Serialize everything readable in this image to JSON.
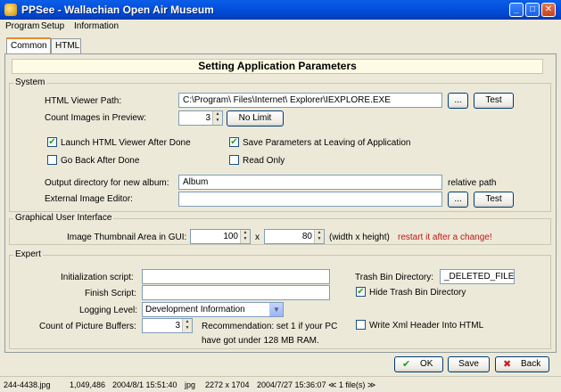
{
  "window": {
    "title": "PPSee - Wallachian Open Air Museum"
  },
  "menu": [
    "Program",
    "Setup",
    "Information"
  ],
  "tabs": [
    "Common",
    "HTML"
  ],
  "header": "Setting Application Parameters",
  "system": {
    "legend": "System",
    "html_viewer_label": "HTML Viewer Path:",
    "html_viewer_value": "C:\\Program\\ Files\\Internet\\ Explorer\\IEXPLORE.EXE",
    "browse_label": "...",
    "test_label": "Test",
    "count_images_label": "Count Images in Preview:",
    "count_images_value": "3",
    "no_limit_label": "No Limit",
    "launch_viewer_label": "Launch HTML Viewer After Done",
    "launch_viewer_checked": true,
    "save_params_label": "Save Parameters at Leaving of Application",
    "save_params_checked": true,
    "go_back_label": "Go Back After Done",
    "go_back_checked": false,
    "read_only_label": "Read Only",
    "read_only_checked": false,
    "output_dir_label": "Output directory for new album:",
    "output_dir_value": "Album",
    "relative_path_label": "relative path",
    "external_editor_label": "External Image Editor:",
    "external_editor_value": "",
    "browse2_label": "...",
    "test2_label": "Test"
  },
  "gui": {
    "legend": "Graphical User Interface",
    "thumb_label": "Image Thumbnail Area in GUI:",
    "width_value": "100",
    "x_label": "x",
    "height_value": "80",
    "wh_label": "(width x height)",
    "restart_label": "restart it after a change!"
  },
  "expert": {
    "legend": "Expert",
    "init_label": "Initialization script:",
    "init_value": "",
    "finish_label": "Finish Script:",
    "finish_value": "",
    "logging_label": "Logging Level:",
    "logging_value": "Development Information",
    "buffers_label": "Count of Picture Buffers:",
    "buffers_value": "3",
    "recommend_line1": "Recommendation: set 1 if your PC",
    "recommend_line2": "have got under 128 MB RAM.",
    "trash_label": "Trash Bin Directory:",
    "trash_value": "_DELETED_FILES",
    "hide_trash_label": "Hide Trash Bin Directory",
    "hide_trash_checked": true,
    "xml_header_label": "Write Xml Header Into HTML",
    "xml_header_checked": false
  },
  "buttons": {
    "ok": "OK",
    "save": "Save",
    "back": "Back"
  },
  "status": {
    "filename": "244-4438.jpg",
    "size": "1,049,486",
    "date1": "2004/8/1 15:51:40",
    "format": "jpg",
    "dimensions": "2272 x 1704",
    "date2": "2004/7/27 15:36:07",
    "count": "≪ 1 file(s) ≫"
  },
  "colors": {
    "titlebar": "#0451dd",
    "warning": "#c01818",
    "header_bg": "#fdfbe3"
  }
}
